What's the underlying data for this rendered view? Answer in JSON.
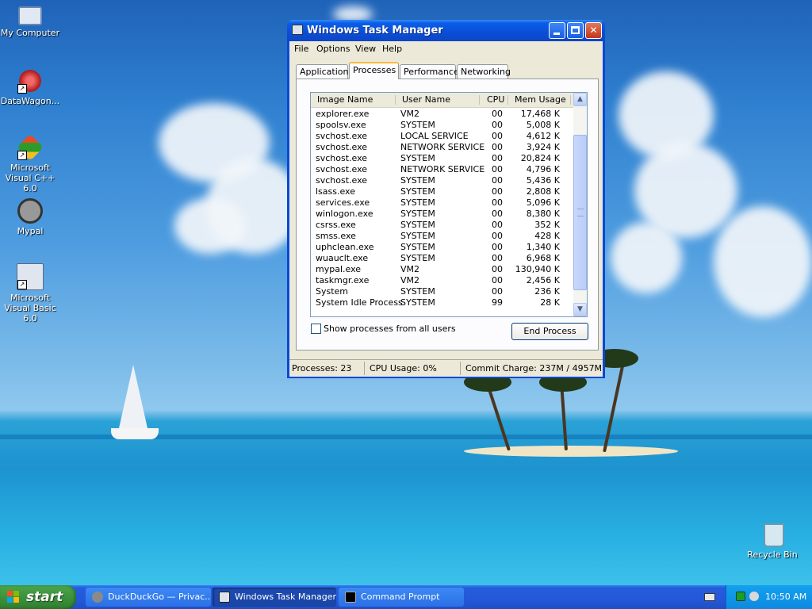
{
  "desktop": {
    "icons": [
      {
        "label": "My Computer"
      },
      {
        "label": "DataWagon..."
      },
      {
        "label": "Microsoft Visual C++ 6.0"
      },
      {
        "label": "Mypal"
      },
      {
        "label": "Microsoft Visual Basic 6.0"
      },
      {
        "label": "Recycle Bin"
      }
    ]
  },
  "window": {
    "title": "Windows Task Manager",
    "menu": [
      "File",
      "Options",
      "View",
      "Help"
    ],
    "tabs": [
      {
        "label": "Applications",
        "active": false
      },
      {
        "label": "Processes",
        "active": true
      },
      {
        "label": "Performance",
        "active": false
      },
      {
        "label": "Networking",
        "active": false
      }
    ],
    "columns": [
      "Image Name",
      "User Name",
      "CPU",
      "Mem Usage"
    ],
    "processes": [
      {
        "name": "explorer.exe",
        "user": "VM2",
        "cpu": "00",
        "mem": "17,468 K"
      },
      {
        "name": "spoolsv.exe",
        "user": "SYSTEM",
        "cpu": "00",
        "mem": "5,008 K"
      },
      {
        "name": "svchost.exe",
        "user": "LOCAL SERVICE",
        "cpu": "00",
        "mem": "4,612 K"
      },
      {
        "name": "svchost.exe",
        "user": "NETWORK SERVICE",
        "cpu": "00",
        "mem": "3,924 K"
      },
      {
        "name": "svchost.exe",
        "user": "SYSTEM",
        "cpu": "00",
        "mem": "20,824 K"
      },
      {
        "name": "svchost.exe",
        "user": "NETWORK SERVICE",
        "cpu": "00",
        "mem": "4,796 K"
      },
      {
        "name": "svchost.exe",
        "user": "SYSTEM",
        "cpu": "00",
        "mem": "5,436 K"
      },
      {
        "name": "lsass.exe",
        "user": "SYSTEM",
        "cpu": "00",
        "mem": "2,808 K"
      },
      {
        "name": "services.exe",
        "user": "SYSTEM",
        "cpu": "00",
        "mem": "5,096 K"
      },
      {
        "name": "winlogon.exe",
        "user": "SYSTEM",
        "cpu": "00",
        "mem": "8,380 K"
      },
      {
        "name": "csrss.exe",
        "user": "SYSTEM",
        "cpu": "00",
        "mem": "352 K"
      },
      {
        "name": "smss.exe",
        "user": "SYSTEM",
        "cpu": "00",
        "mem": "428 K"
      },
      {
        "name": "uphclean.exe",
        "user": "SYSTEM",
        "cpu": "00",
        "mem": "1,340 K"
      },
      {
        "name": "wuauclt.exe",
        "user": "SYSTEM",
        "cpu": "00",
        "mem": "6,968 K"
      },
      {
        "name": "mypal.exe",
        "user": "VM2",
        "cpu": "00",
        "mem": "130,940 K"
      },
      {
        "name": "taskmgr.exe",
        "user": "VM2",
        "cpu": "00",
        "mem": "2,456 K"
      },
      {
        "name": "System",
        "user": "SYSTEM",
        "cpu": "00",
        "mem": "236 K"
      },
      {
        "name": "System Idle Process",
        "user": "SYSTEM",
        "cpu": "99",
        "mem": "28 K"
      }
    ],
    "show_all_label": "Show processes from all users",
    "show_all_checked": false,
    "end_process_label": "End Process",
    "status": {
      "processes": "Processes: 23",
      "cpu": "CPU Usage: 0%",
      "commit": "Commit Charge: 237M / 4957M"
    }
  },
  "taskbar": {
    "start_label": "start",
    "tasks": [
      {
        "label": "DuckDuckGo — Privac...",
        "active": false,
        "icon": "raccoon-icon"
      },
      {
        "label": "Windows Task Manager",
        "active": true,
        "icon": "task-manager-icon"
      },
      {
        "label": "Command Prompt",
        "active": false,
        "icon": "command-prompt-icon"
      }
    ],
    "clock": "10:50 AM"
  },
  "colors": {
    "titlebar": "#0a4fd8",
    "window_bg": "#ece9d8",
    "start_green": "#3a8f3a",
    "taskbar_blue": "#2458d8",
    "tab_highlight": "#fdbb39"
  }
}
